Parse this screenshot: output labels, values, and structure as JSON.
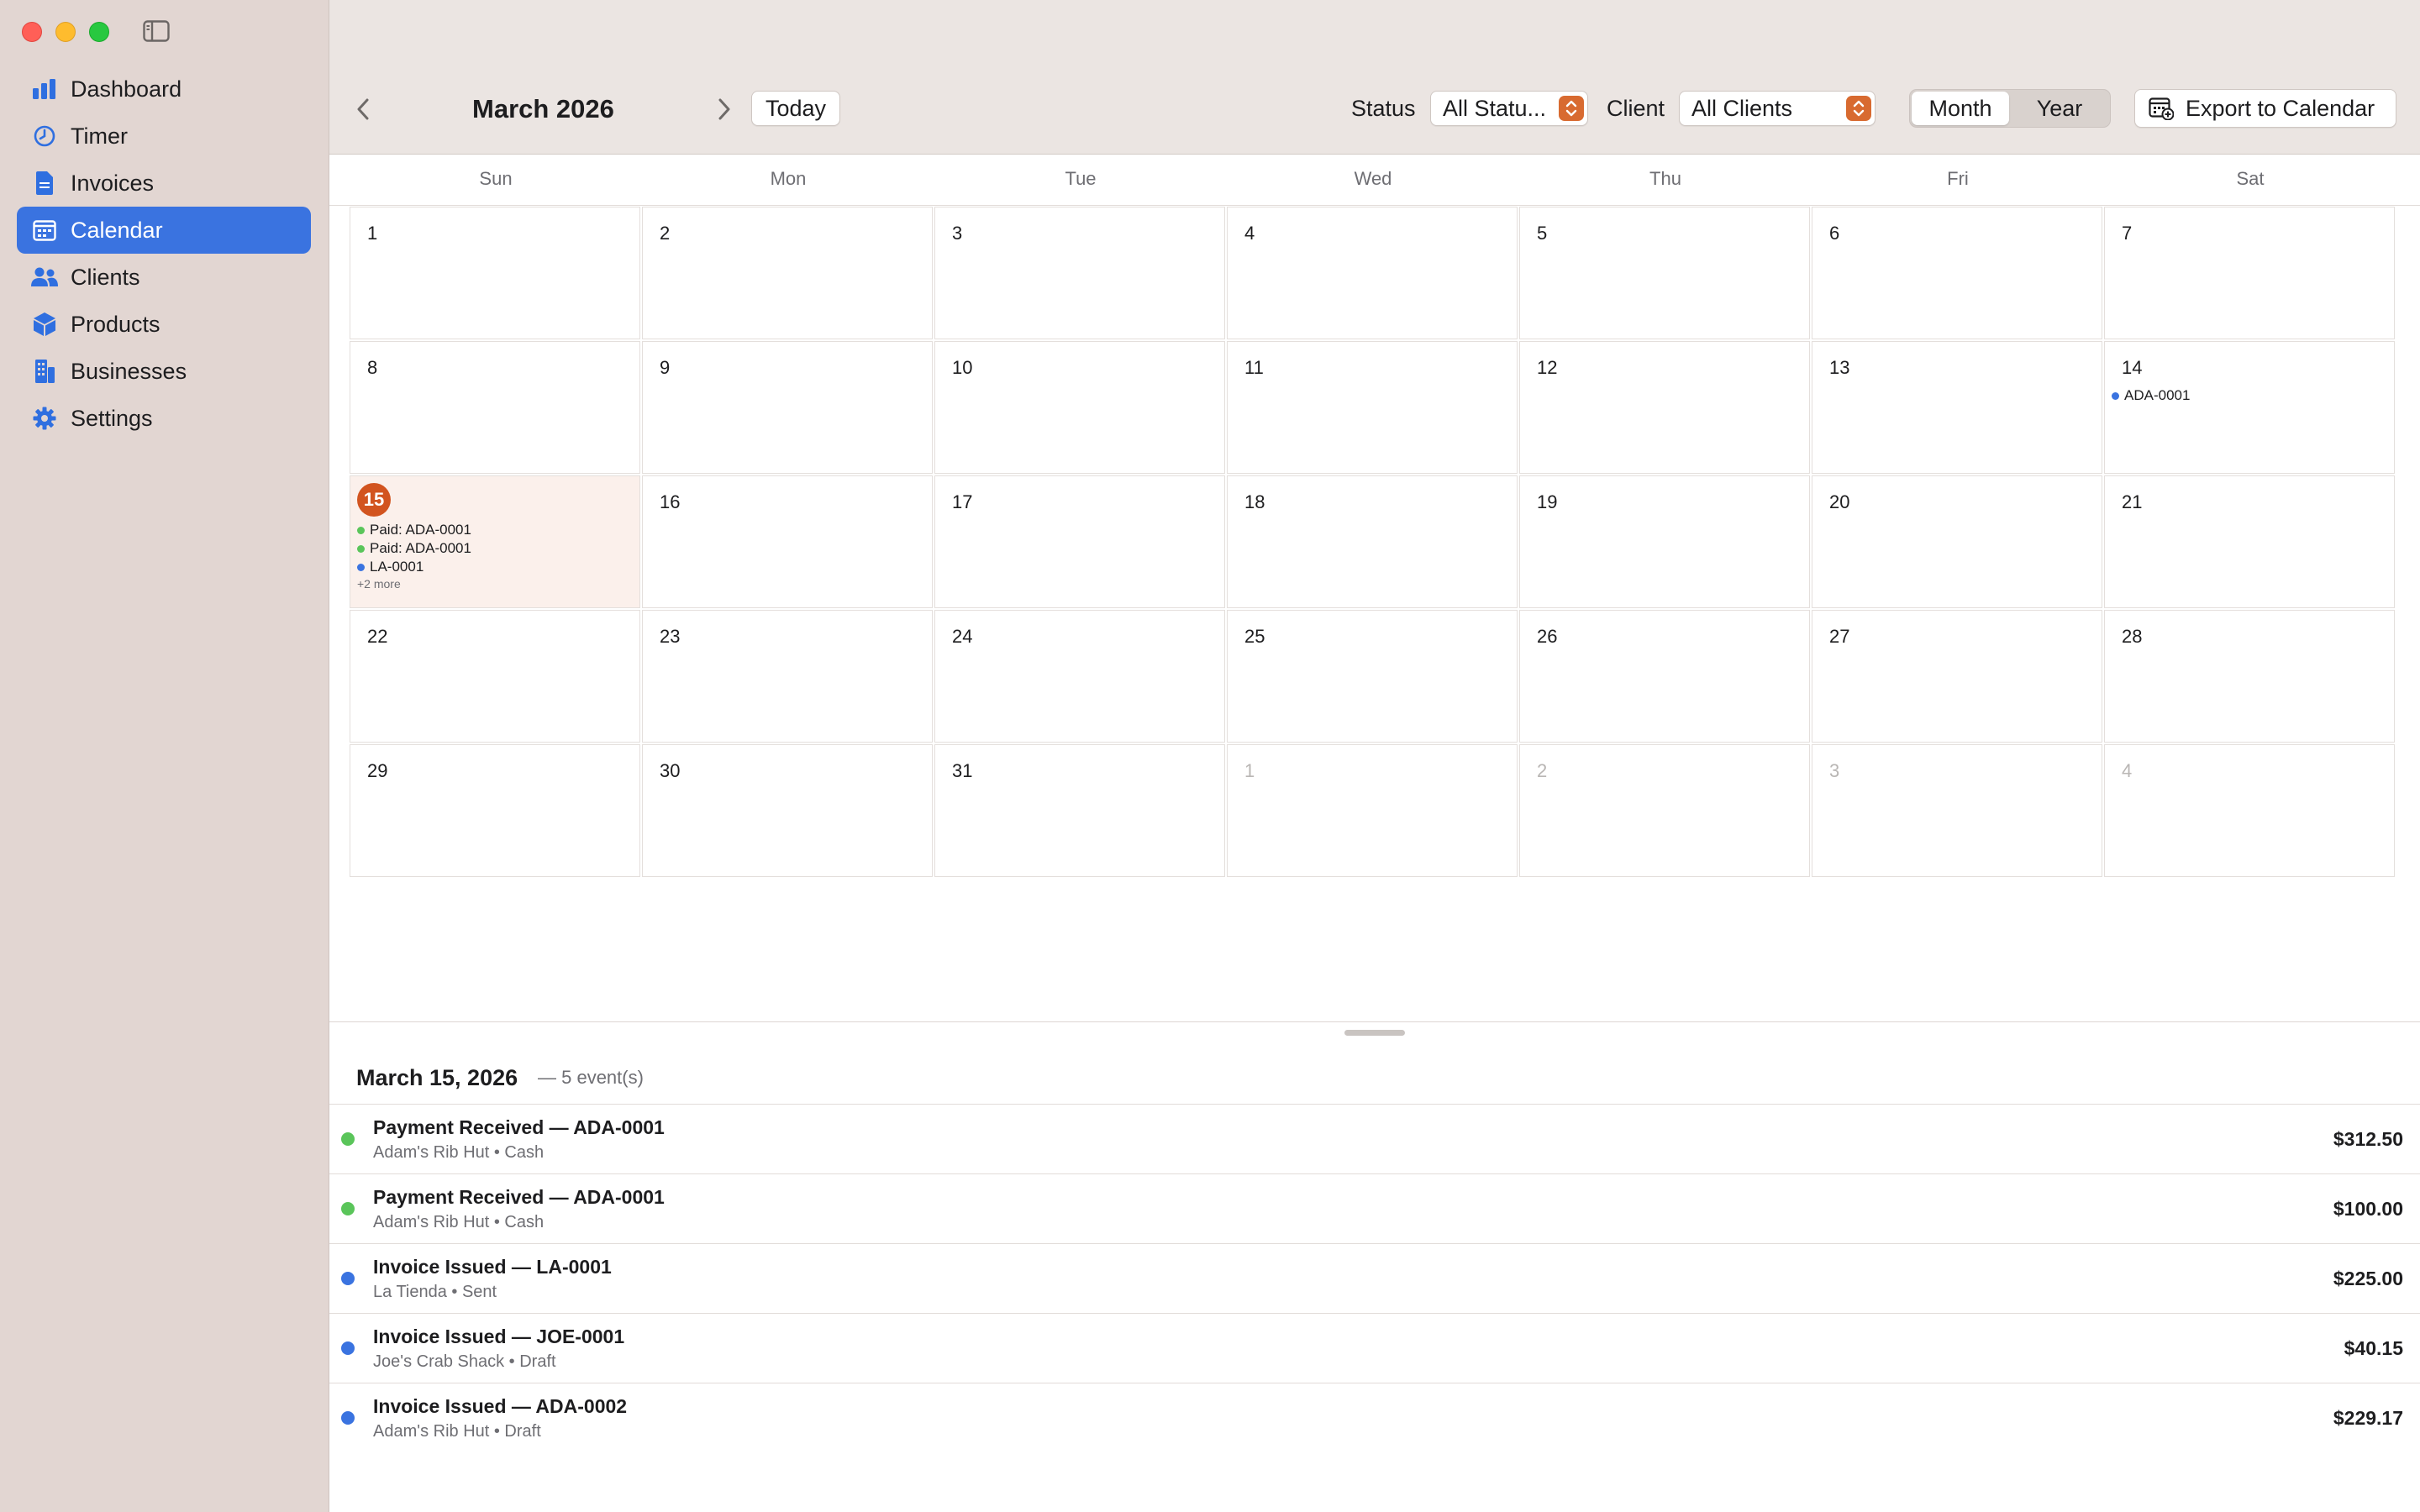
{
  "colors": {
    "accent": "#3a73e0",
    "today": "#d2541f",
    "paid": "#5ac55a",
    "issued": "#3a73e0",
    "stepper": "#d86a30"
  },
  "sidebar": {
    "items": [
      {
        "label": "Dashboard",
        "icon": "chart-bar-icon"
      },
      {
        "label": "Timer",
        "icon": "timer-icon"
      },
      {
        "label": "Invoices",
        "icon": "document-icon"
      },
      {
        "label": "Calendar",
        "icon": "calendar-icon",
        "active": true
      },
      {
        "label": "Clients",
        "icon": "people-icon"
      },
      {
        "label": "Products",
        "icon": "box-icon"
      },
      {
        "label": "Businesses",
        "icon": "building-icon"
      },
      {
        "label": "Settings",
        "icon": "gear-icon"
      }
    ]
  },
  "toolbar": {
    "month_title": "March 2026",
    "today_label": "Today",
    "status_label": "Status",
    "status_value": "All Statu...",
    "client_label": "Client",
    "client_value": "All Clients",
    "view_month": "Month",
    "view_year": "Year",
    "export_label": "Export to Calendar"
  },
  "calendar": {
    "weekdays": [
      "Sun",
      "Mon",
      "Tue",
      "Wed",
      "Thu",
      "Fri",
      "Sat"
    ],
    "today": 15,
    "weeks": [
      [
        {
          "day": "1"
        },
        {
          "day": "2"
        },
        {
          "day": "3"
        },
        {
          "day": "4"
        },
        {
          "day": "5"
        },
        {
          "day": "6"
        },
        {
          "day": "7"
        }
      ],
      [
        {
          "day": "8"
        },
        {
          "day": "9"
        },
        {
          "day": "10"
        },
        {
          "day": "11"
        },
        {
          "day": "12"
        },
        {
          "day": "13"
        },
        {
          "day": "14",
          "events": [
            {
              "label": "ADA-0001",
              "kind": "issued"
            }
          ]
        }
      ],
      [
        {
          "day": "15",
          "today": true,
          "events": [
            {
              "label": "Paid: ADA-0001",
              "kind": "paid"
            },
            {
              "label": "Paid: ADA-0001",
              "kind": "paid"
            },
            {
              "label": "LA-0001",
              "kind": "issued"
            }
          ],
          "more": "+2 more"
        },
        {
          "day": "16"
        },
        {
          "day": "17"
        },
        {
          "day": "18"
        },
        {
          "day": "19"
        },
        {
          "day": "20"
        },
        {
          "day": "21"
        }
      ],
      [
        {
          "day": "22"
        },
        {
          "day": "23"
        },
        {
          "day": "24"
        },
        {
          "day": "25"
        },
        {
          "day": "26"
        },
        {
          "day": "27"
        },
        {
          "day": "28"
        }
      ],
      [
        {
          "day": "29"
        },
        {
          "day": "30"
        },
        {
          "day": "31"
        },
        {
          "day": "1",
          "other": true
        },
        {
          "day": "2",
          "other": true
        },
        {
          "day": "3",
          "other": true
        },
        {
          "day": "4",
          "other": true
        }
      ]
    ]
  },
  "detail": {
    "date": "March 15, 2026",
    "count": "— 5 event(s)",
    "events": [
      {
        "title": "Payment Received — ADA-0001",
        "subtitle": "Adam's Rib Hut • Cash",
        "amount": "$312.50",
        "kind": "paid"
      },
      {
        "title": "Payment Received — ADA-0001",
        "subtitle": "Adam's Rib Hut • Cash",
        "amount": "$100.00",
        "kind": "paid"
      },
      {
        "title": "Invoice Issued — LA-0001",
        "subtitle": "La Tienda • Sent",
        "amount": "$225.00",
        "kind": "issued"
      },
      {
        "title": "Invoice Issued — JOE-0001",
        "subtitle": "Joe's Crab Shack • Draft",
        "amount": "$40.15",
        "kind": "issued"
      },
      {
        "title": "Invoice Issued — ADA-0002",
        "subtitle": "Adam's Rib Hut • Draft",
        "amount": "$229.17",
        "kind": "issued"
      }
    ]
  }
}
